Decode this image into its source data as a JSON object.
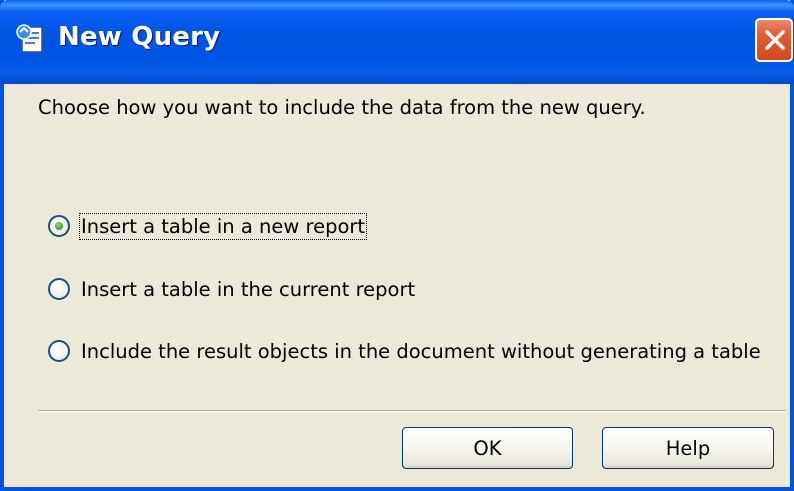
{
  "window": {
    "title": "New Query",
    "title_icon": "query-document-icon",
    "close_icon": "close-icon"
  },
  "instruction": "Choose how you want to include the data from the new query.",
  "options": [
    {
      "label": "Insert a table in a new report",
      "checked": true
    },
    {
      "label": "Insert a table in the current report",
      "checked": false
    },
    {
      "label": "Include the result objects in the document without generating a table",
      "checked": false
    }
  ],
  "buttons": {
    "ok_label": "OK",
    "help_label": "Help"
  },
  "colors": {
    "titlebar": "#0054e3",
    "dialog_bg": "#ece9d8",
    "close_button": "#e25d36",
    "radio_dot": "#3fae2c"
  }
}
